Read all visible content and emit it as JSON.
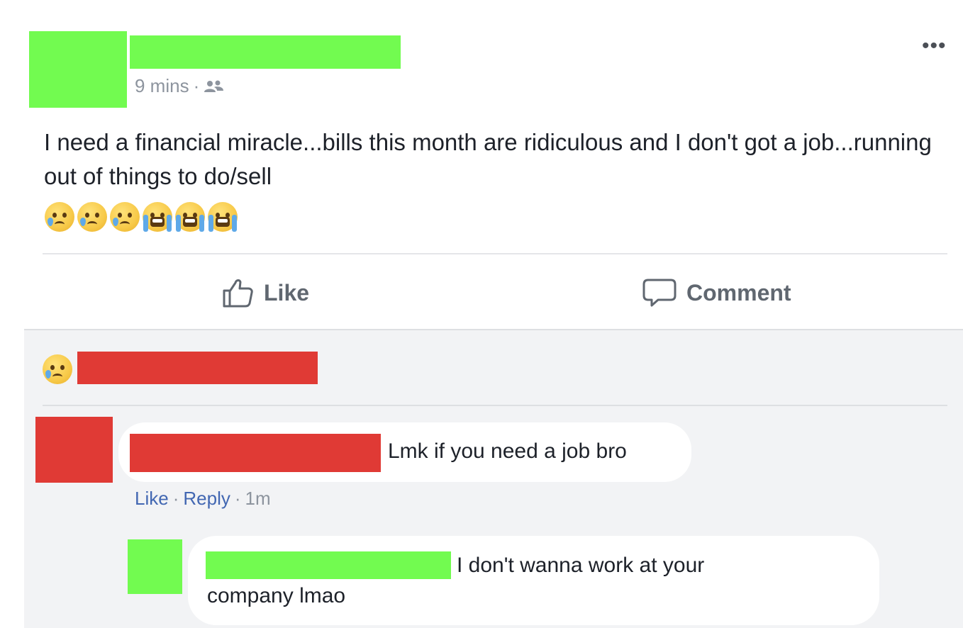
{
  "post": {
    "time": "9 mins",
    "separator": "·",
    "audience_icon": "friends-icon",
    "more_label": "•••",
    "text": "I need a financial miracle...bills this month are ridiculous and I don't got a job...running out of things to do/sell",
    "emojis": [
      "sad-tear-emoji",
      "sad-tear-emoji",
      "sad-tear-emoji",
      "crying-emoji",
      "crying-emoji",
      "crying-emoji"
    ]
  },
  "actions": {
    "like_label": "Like",
    "comment_label": "Comment"
  },
  "reactions": {
    "icon": "sad-reaction-icon"
  },
  "comments": [
    {
      "text": "Lmk if you need a job bro",
      "like_label": "Like",
      "reply_label": "Reply",
      "time": "1m",
      "separator": "·"
    },
    {
      "text_line1": "I don't wanna work at your",
      "text_line2": "company lmao"
    }
  ],
  "colors": {
    "redaction_green": "#72fb50",
    "redaction_red": "#e03a35",
    "link_blue": "#4267b2",
    "meta_gray": "#8d949e",
    "comment_bg": "#f2f3f5"
  }
}
